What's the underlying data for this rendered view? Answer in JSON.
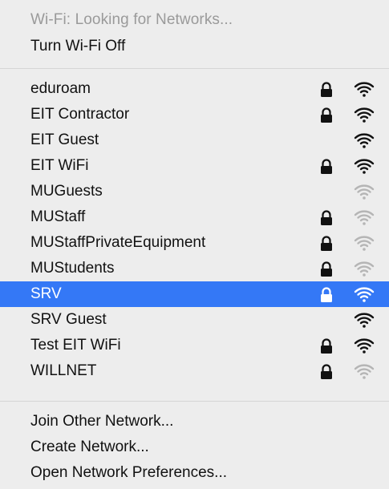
{
  "status_text": "Wi-Fi: Looking for Networks...",
  "toggle_label": "Turn Wi-Fi Off",
  "networks": [
    {
      "name": "eduroam",
      "locked": true,
      "signal": "strong",
      "selected": false
    },
    {
      "name": "EIT Contractor",
      "locked": true,
      "signal": "strong",
      "selected": false
    },
    {
      "name": "EIT Guest",
      "locked": false,
      "signal": "strong",
      "selected": false
    },
    {
      "name": "EIT WiFi",
      "locked": true,
      "signal": "strong",
      "selected": false
    },
    {
      "name": "MUGuests",
      "locked": false,
      "signal": "weak",
      "selected": false
    },
    {
      "name": "MUStaff",
      "locked": true,
      "signal": "weak",
      "selected": false
    },
    {
      "name": "MUStaffPrivateEquipment",
      "locked": true,
      "signal": "weak",
      "selected": false
    },
    {
      "name": "MUStudents",
      "locked": true,
      "signal": "weak",
      "selected": false
    },
    {
      "name": "SRV",
      "locked": true,
      "signal": "strong",
      "selected": true
    },
    {
      "name": "SRV Guest",
      "locked": false,
      "signal": "strong",
      "selected": false
    },
    {
      "name": "Test EIT WiFi",
      "locked": true,
      "signal": "strong",
      "selected": false
    },
    {
      "name": "WILLNET",
      "locked": true,
      "signal": "faint",
      "selected": false
    }
  ],
  "actions": {
    "join_other": "Join Other Network...",
    "create": "Create Network...",
    "preferences": "Open Network Preferences..."
  },
  "colors": {
    "menu_bg": "#ededed",
    "selection": "#3478f6",
    "text": "#111111",
    "disabled_text": "#9a9a9a",
    "weak_signal": "#b5b5b5"
  },
  "icons": {
    "lock": "lock-icon",
    "wifi": "wifi-signal-icon"
  }
}
